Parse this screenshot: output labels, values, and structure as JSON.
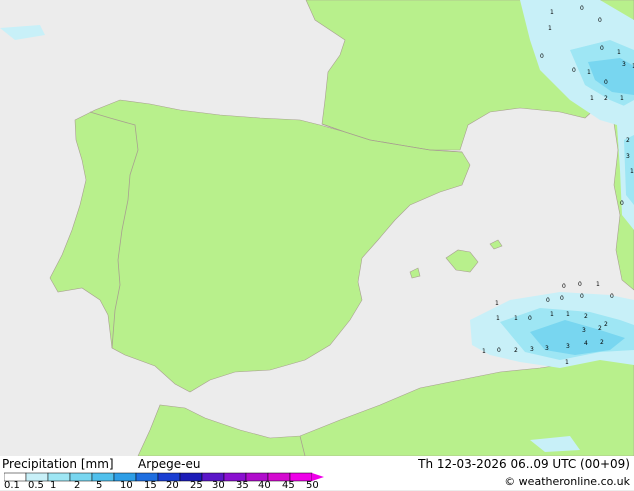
{
  "legend": {
    "title": "Precipitation [mm]",
    "model": "Arpege-eu",
    "validity": "Th 12-03-2026 06..09 UTC (00+09)",
    "credit": "© weatheronline.co.uk",
    "ticks": [
      "0.1",
      "0.5",
      "1",
      "2",
      "5",
      "10",
      "15",
      "20",
      "25",
      "30",
      "35",
      "40",
      "45",
      "50"
    ],
    "colors": [
      "#ffffff",
      "#c8f0f8",
      "#9ee6f4",
      "#78d6f0",
      "#50c0ec",
      "#2e9ee6",
      "#1e6ee0",
      "#1a3ed2",
      "#1c1cb8",
      "#5a16c8",
      "#8a10d0",
      "#b00ccc",
      "#d40ad0",
      "#ee00e8"
    ]
  },
  "map": {
    "sea_color": "#ececec",
    "land_color": "#b8f08c",
    "border_color": "#b0a890",
    "precip_values": [
      {
        "v": "1"
      },
      {
        "v": "0"
      },
      {
        "v": "0"
      },
      {
        "v": "1"
      },
      {
        "v": "0"
      },
      {
        "v": "1"
      },
      {
        "v": "0"
      },
      {
        "v": "3"
      },
      {
        "v": "1"
      },
      {
        "v": "0"
      },
      {
        "v": "0"
      },
      {
        "v": "1"
      },
      {
        "v": "1"
      },
      {
        "v": "2"
      },
      {
        "v": "1"
      },
      {
        "v": "2"
      },
      {
        "v": "3"
      },
      {
        "v": "1"
      },
      {
        "v": "0"
      },
      {
        "v": "1"
      },
      {
        "v": "0"
      },
      {
        "v": "0"
      },
      {
        "v": "0"
      },
      {
        "v": "1"
      },
      {
        "v": "0"
      },
      {
        "v": "0"
      },
      {
        "v": "0"
      },
      {
        "v": "1"
      },
      {
        "v": "1"
      },
      {
        "v": "1"
      },
      {
        "v": "0"
      },
      {
        "v": "1"
      },
      {
        "v": "2"
      },
      {
        "v": "2"
      },
      {
        "v": "3"
      },
      {
        "v": "2"
      },
      {
        "v": "3"
      },
      {
        "v": "3"
      },
      {
        "v": "4"
      },
      {
        "v": "2"
      },
      {
        "v": "1"
      },
      {
        "v": "0"
      },
      {
        "v": "2"
      },
      {
        "v": "3"
      },
      {
        "v": "1"
      }
    ]
  }
}
